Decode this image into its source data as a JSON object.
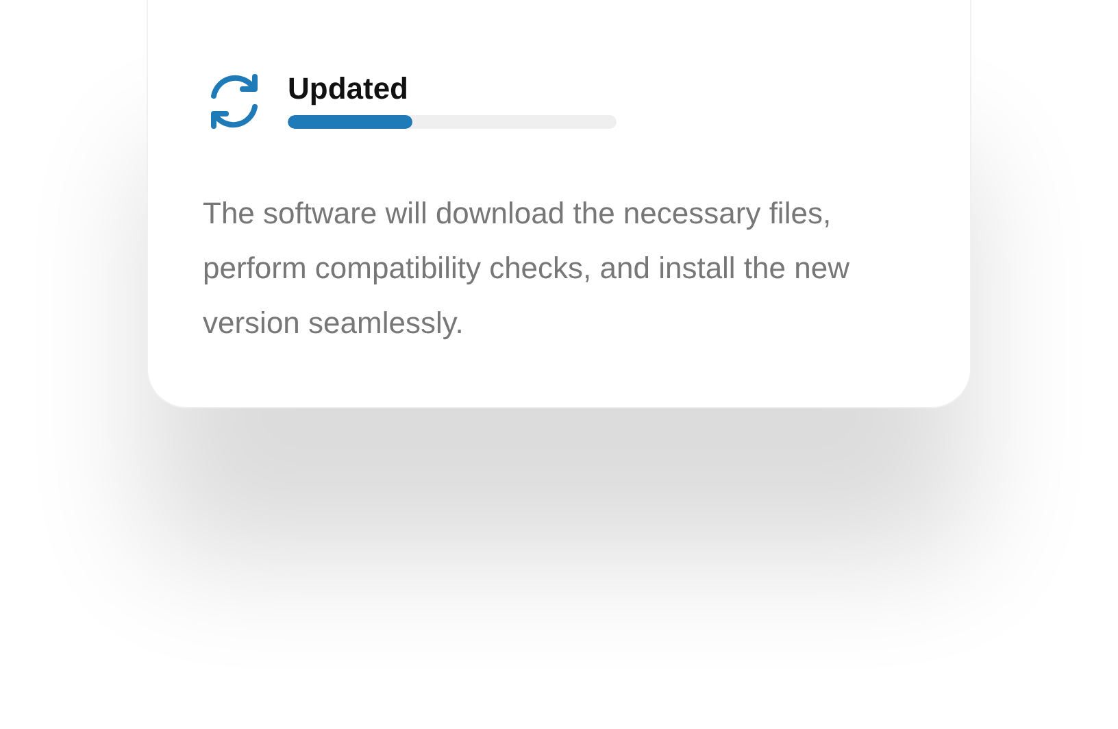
{
  "card": {
    "title": "Updated",
    "progress": {
      "level": 0.38
    },
    "description": "The software will download the necessary files, perform compatibility checks, and install the new version seamlessly."
  }
}
